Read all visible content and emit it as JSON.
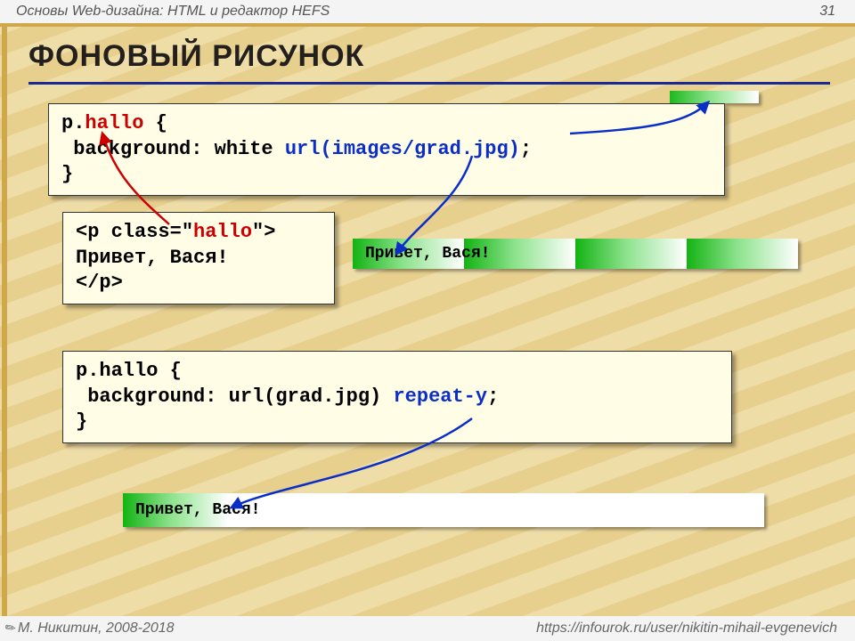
{
  "breadcrumb": "Основы Web-дизайна: HTML и редактор HEFS",
  "page_number": "31",
  "title": "ФОНОВЫЙ РИСУНОК",
  "code1": {
    "l1a": "p.",
    "l1b": "hallo",
    "l1c": " {",
    "l2a": " background: white ",
    "l2b": "url(images/grad.jpg)",
    "l2c": ";",
    "l3": "}"
  },
  "code2": {
    "l1a": "<p class=\"",
    "l1b": "hallo",
    "l1c": "\">",
    "l2": "Привет, Вася!",
    "l3": "</p>"
  },
  "code3": {
    "l1": "p.hallo {",
    "l2a": " background: url(grad.jpg) ",
    "l2b": "repeat-y",
    "l2c": ";",
    "l3": "}"
  },
  "hello1_text": "Привет, Вася!",
  "hello2_text": "Привет, Вася!",
  "footer_left": "М. Никитин, 2008-2018",
  "footer_right": "https://infourok.ru/user/nikitin-mihail-evgenevich"
}
